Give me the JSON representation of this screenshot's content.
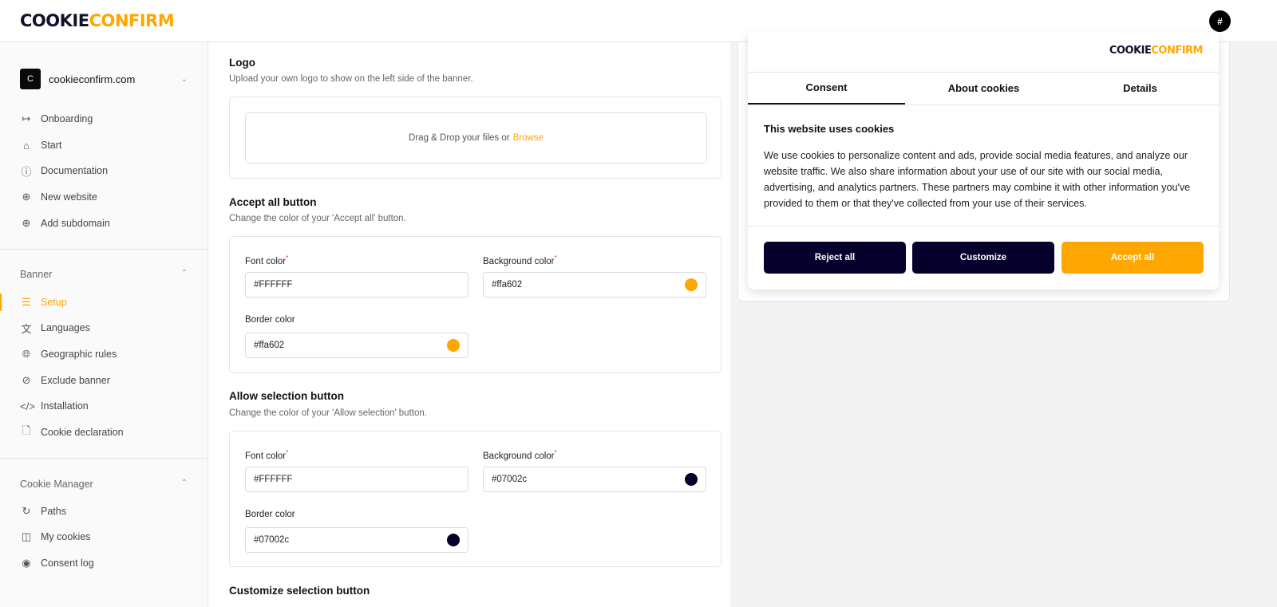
{
  "header": {
    "logo_a": "COOKIE",
    "logo_b": "CONFIRM",
    "avatar": "#"
  },
  "sidebar": {
    "site": {
      "initial": "C",
      "name": "cookieconfirm.com"
    },
    "items": [
      {
        "label": "Onboarding"
      },
      {
        "label": "Start"
      },
      {
        "label": "Documentation"
      },
      {
        "label": "New website"
      },
      {
        "label": "Add subdomain"
      }
    ],
    "banner_section": "Banner",
    "banner_items": [
      {
        "label": "Setup"
      },
      {
        "label": "Languages"
      },
      {
        "label": "Geographic rules"
      },
      {
        "label": "Exclude banner"
      },
      {
        "label": "Installation"
      },
      {
        "label": "Cookie declaration"
      }
    ],
    "manager_section": "Cookie Manager",
    "manager_items": [
      {
        "label": "Paths"
      },
      {
        "label": "My cookies"
      },
      {
        "label": "Consent log"
      }
    ]
  },
  "main": {
    "logo": {
      "title": "Logo",
      "desc": "Upload your own logo to show on the left side of the banner.",
      "drop": "Drag & Drop your files or",
      "browse": "Browse"
    },
    "accept": {
      "title": "Accept all button",
      "desc": "Change the color of your 'Accept all' button.",
      "font_label": "Font color",
      "font": "#FFFFFF",
      "bg_label": "Background color",
      "bg": "#ffa602",
      "border_label": "Border color",
      "border": "#ffa602"
    },
    "allow": {
      "title": "Allow selection button",
      "desc": "Change the color of your 'Allow selection' button.",
      "font_label": "Font color",
      "font": "#FFFFFF",
      "bg_label": "Background color",
      "bg": "#07002c",
      "border_label": "Border color",
      "border": "#07002c"
    },
    "customize": {
      "title": "Customize selection button"
    }
  },
  "preview": {
    "tabs": [
      "Consent",
      "About cookies",
      "Details"
    ],
    "title": "This website uses cookies",
    "text": "We use cookies to personalize content and ads, provide social media features, and analyze our website traffic. We also share information about your use of our site with our social media, advertising, and analytics partners. These partners may combine it with other information you've provided to them or that they've collected from your use of their services.",
    "buttons": {
      "reject": "Reject all",
      "customize": "Customize",
      "accept": "Accept all"
    }
  },
  "colors": {
    "accent": "#ffa602",
    "navy": "#07002c"
  }
}
